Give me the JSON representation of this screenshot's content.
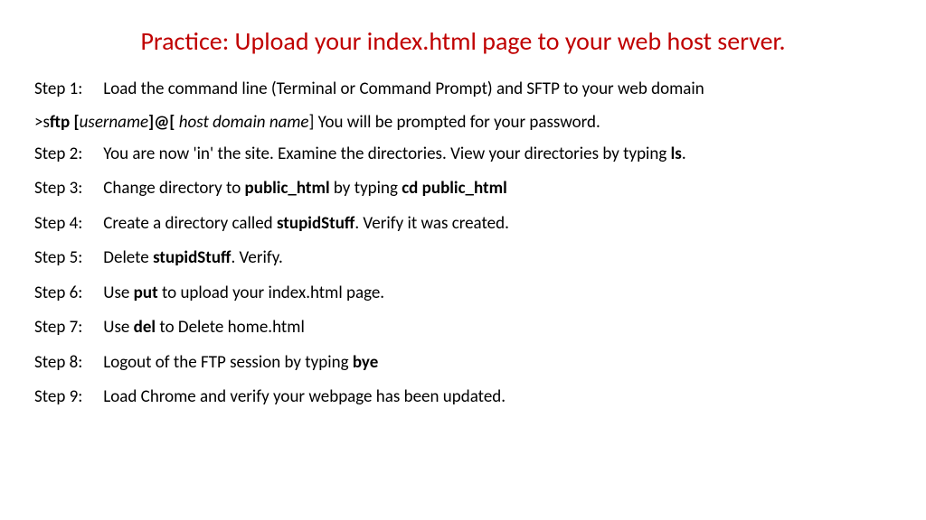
{
  "title": {
    "prefix": "Practice:  Upload your ",
    "highlight": "index.html",
    "suffix": " page to your web host server."
  },
  "step1": {
    "label": "Step 1:",
    "text": "Load the command line (Terminal or  Command Prompt) and SFTP to your web domain"
  },
  "cmd": {
    "prompt": ">s",
    "ftp": "ftp  [",
    "user": "username",
    "at": "]@[",
    "host": " host domain name",
    "close": "]   You will be prompted for your password."
  },
  "step2": {
    "label": "Step 2:",
    "pre": "You are now 'in' the site.  Examine the directories. View your directories by typing ",
    "cmd": "ls",
    "post": "."
  },
  "step3": {
    "label": "Step 3:",
    "pre": "Change directory to ",
    "dir": "public_html",
    "mid": " by typing ",
    "cmd": "cd public_html"
  },
  "step4": {
    "label": "Step 4:",
    "pre": "Create a directory called ",
    "dir": "stupidStuff",
    "post": ".  Verify it was created."
  },
  "step5": {
    "label": "Step 5:",
    "pre": "Delete ",
    "dir": "stupidStuff",
    "post": ". Verify."
  },
  "step6": {
    "label": "Step 6:",
    "pre": "Use ",
    "cmd": "put",
    "post": " to upload your index.html page."
  },
  "step7": {
    "label": "Step 7:",
    "pre": "Use ",
    "cmd": "del",
    "post": " to Delete home.html"
  },
  "step8": {
    "label": "Step 8:",
    "pre": "Logout of the FTP session by typing ",
    "cmd": "bye"
  },
  "step9": {
    "label": "Step 9:",
    "text": "Load Chrome and verify your webpage has been updated."
  }
}
